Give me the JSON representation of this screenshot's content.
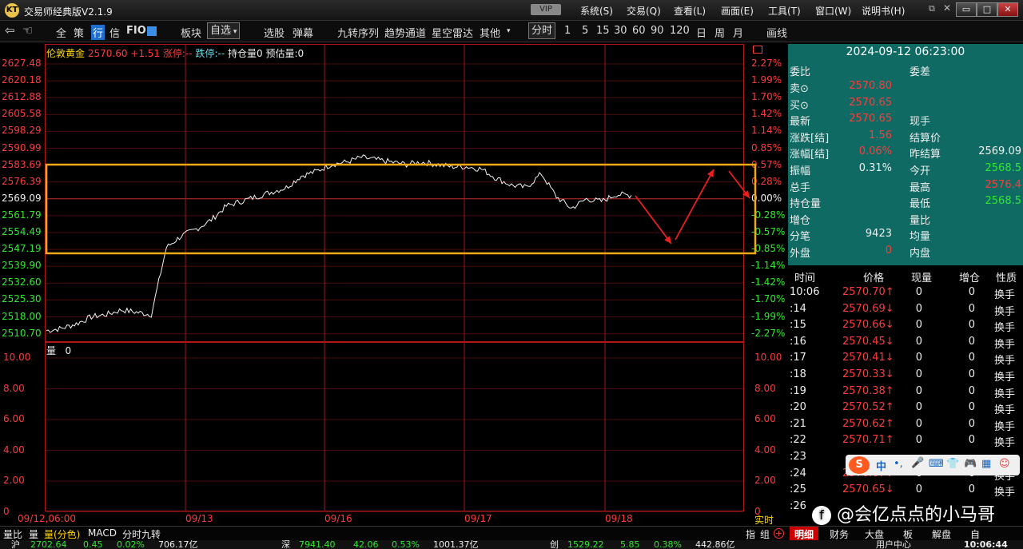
{
  "app": {
    "logo": "KT",
    "title": "交易师经典版V2.1.9",
    "vip": "VIP"
  },
  "menu": [
    "系统(S)",
    "交易(Q)",
    "查看(L)",
    "画面(E)",
    "工具(T)",
    "窗口(W)",
    "说明书(H)"
  ],
  "window_buttons": [
    "□",
    "▭",
    "✕"
  ],
  "toolbar": {
    "items": [
      "全",
      "策",
      "行",
      "信",
      "FIO"
    ],
    "block": "板块",
    "selfselect": "自选",
    "group2": [
      "选股",
      "弹幕"
    ],
    "group3": [
      "九转序列",
      "趋势通道",
      "星空雷达",
      "其他"
    ],
    "periods": [
      "分时",
      "1",
      "5",
      "15",
      "30",
      "60",
      "90",
      "120",
      "日",
      "周",
      "月"
    ],
    "draw": "画线"
  },
  "header": {
    "name": "伦敦黄金",
    "price": "2570.60",
    "change": "+1.51",
    "limit_up": "涨停:--",
    "limit_down": "跌停:--",
    "open_interest": "持仓量0",
    "est_volume": "预估量:0"
  },
  "price_axis_left": [
    "2627.48",
    "2620.18",
    "2612.88",
    "2605.58",
    "2598.29",
    "2590.99",
    "2583.69",
    "2576.39",
    "2569.09",
    "2561.79",
    "2554.49",
    "2547.19",
    "2539.90",
    "2532.60",
    "2525.30",
    "2518.00",
    "2510.70"
  ],
  "pct_axis_right": [
    "2.27%",
    "1.99%",
    "1.70%",
    "1.42%",
    "1.14%",
    "0.85%",
    "0.57%",
    "0.28%",
    "0.00%",
    "-0.28%",
    "-0.57%",
    "-0.85%",
    "-1.14%",
    "-1.42%",
    "-1.70%",
    "-1.99%",
    "-2.27%"
  ],
  "volume": {
    "label": "量",
    "value": "0",
    "axis": [
      "10.00",
      "8.00",
      "6.00",
      "4.00",
      "2.00",
      "0"
    ],
    "realtime": "实时"
  },
  "dates": [
    "09/12,06:00",
    "09/13",
    "09/16",
    "09/17",
    "09/18"
  ],
  "chart_data": {
    "type": "line",
    "title": "伦敦黄金",
    "xlabel": "",
    "ylabel": "",
    "ylim": [
      2510.7,
      2627.48
    ],
    "prev_settle": 2569.09,
    "x": [
      "09/12,06:00",
      "09/12",
      "09/12",
      "09/12",
      "09/12",
      "09/12",
      "09/12",
      "09/12",
      "09/13",
      "09/13",
      "09/13",
      "09/13",
      "09/13",
      "09/13",
      "09/13",
      "09/13",
      "09/13",
      "09/13",
      "09/16",
      "09/16",
      "09/16",
      "09/16",
      "09/16",
      "09/16",
      "09/16",
      "09/16",
      "09/16",
      "09/16",
      "09/17",
      "09/17",
      "09/17",
      "09/17",
      "09/17",
      "09/17",
      "09/17",
      "09/17",
      "09/18",
      "09/18",
      "09/18",
      "09/18"
    ],
    "series": [
      {
        "values": [
          2512,
          2513,
          2515,
          2518,
          2519,
          2521,
          2520,
          2519,
          2548,
          2553,
          2556,
          2560,
          2566,
          2568,
          2570,
          2572,
          2574,
          2579,
          2581,
          2584,
          2585,
          2587,
          2586,
          2585,
          2584,
          2585,
          2584,
          2583,
          2583,
          2582,
          2578,
          2575,
          2574,
          2580,
          2570,
          2565,
          2569,
          2568,
          2571,
          2570.6
        ]
      }
    ],
    "grid": true
  },
  "quote": {
    "datetime": "2024-09-12 06:23:00",
    "wb_label": "委比",
    "wc_label": "委差",
    "rows": [
      {
        "k": "卖⊙",
        "v": "2570.80",
        "vc": "red",
        "k2": "",
        "v2": "",
        "v2c": "white"
      },
      {
        "k": "买⊙",
        "v": "2570.65",
        "vc": "red",
        "k2": "",
        "v2": "",
        "v2c": "white"
      },
      {
        "k": "最新",
        "v": "2570.65",
        "vc": "red",
        "k2": "现手",
        "v2": "",
        "v2c": "white"
      },
      {
        "k": "涨跌[结]",
        "v": "1.56",
        "vc": "red",
        "k2": "结算价",
        "v2": "",
        "v2c": "white"
      },
      {
        "k": "涨幅[结]",
        "v": "0.06%",
        "vc": "red",
        "k2": "昨结算",
        "v2": "2569.09",
        "v2c": "white"
      },
      {
        "k": "振幅",
        "v": "0.31%",
        "vc": "white",
        "k2": "今开",
        "v2": "2568.5",
        "v2c": "green"
      },
      {
        "k": "总手",
        "v": "",
        "vc": "white",
        "k2": "最高",
        "v2": "2576.4",
        "v2c": "red"
      },
      {
        "k": "持仓量",
        "v": "",
        "vc": "white",
        "k2": "最低",
        "v2": "2568.5",
        "v2c": "green"
      },
      {
        "k": "增仓",
        "v": "",
        "vc": "white",
        "k2": "量比",
        "v2": "",
        "v2c": "white"
      },
      {
        "k": "分笔",
        "v": "9423",
        "vc": "white",
        "k2": "均量",
        "v2": "",
        "v2c": "white"
      },
      {
        "k": "外盘",
        "v": "0",
        "vc": "red",
        "k2": "内盘",
        "v2": "",
        "v2c": "white"
      }
    ]
  },
  "trades": {
    "headers": [
      "时间",
      "价格",
      "现量",
      "增仓",
      "性质"
    ],
    "rows": [
      {
        "t": "10:06",
        "p": "2570.70↑",
        "q": "0",
        "z": "0",
        "x": "换手",
        "pc": "red"
      },
      {
        "t": ":14",
        "p": "2570.69↓",
        "q": "0",
        "z": "0",
        "x": "换手",
        "pc": "red"
      },
      {
        "t": ":15",
        "p": "2570.66↓",
        "q": "0",
        "z": "0",
        "x": "换手",
        "pc": "red"
      },
      {
        "t": ":16",
        "p": "2570.45↓",
        "q": "0",
        "z": "0",
        "x": "换手",
        "pc": "red"
      },
      {
        "t": ":17",
        "p": "2570.41↓",
        "q": "0",
        "z": "0",
        "x": "换手",
        "pc": "red"
      },
      {
        "t": ":18",
        "p": "2570.33↓",
        "q": "0",
        "z": "0",
        "x": "换手",
        "pc": "red"
      },
      {
        "t": ":19",
        "p": "2570.38↑",
        "q": "0",
        "z": "0",
        "x": "换手",
        "pc": "red"
      },
      {
        "t": ":20",
        "p": "2570.52↑",
        "q": "0",
        "z": "0",
        "x": "换手",
        "pc": "red"
      },
      {
        "t": ":21",
        "p": "2570.62↑",
        "q": "0",
        "z": "0",
        "x": "换手",
        "pc": "red"
      },
      {
        "t": ":22",
        "p": "2570.71↑",
        "q": "0",
        "z": "0",
        "x": "换手",
        "pc": "red"
      },
      {
        "t": ":23",
        "p": "",
        "q": "",
        "z": "",
        "x": "",
        "pc": "red"
      },
      {
        "t": ":24",
        "p": "2570.67↓",
        "q": "0",
        "z": "0",
        "x": "换手",
        "pc": "red"
      },
      {
        "t": ":25",
        "p": "2570.65↓",
        "q": "0",
        "z": "0",
        "x": "换手",
        "pc": "red"
      },
      {
        "t": ":26",
        "p": "",
        "q": "",
        "z": "",
        "x": "",
        "pc": "red"
      }
    ]
  },
  "bottom_left_tabs": [
    "量比",
    "量",
    "量(分色)",
    "MACD",
    "分时九转"
  ],
  "bottom_right": {
    "indicator": "指",
    "group": "组",
    "tabs": [
      "明细",
      "财务",
      "大盘",
      "板",
      "解盘",
      "自"
    ]
  },
  "status": {
    "items": [
      {
        "name": "沪",
        "value": "2702.64",
        "chg": "0.45",
        "pct": "0.02%",
        "amt": "706.17亿"
      },
      {
        "name": "深",
        "value": "7941.40",
        "chg": "42.06",
        "pct": "0.53%",
        "amt": "1001.37亿"
      },
      {
        "name": "创",
        "value": "1529.22",
        "chg": "5.85",
        "pct": "0.38%",
        "amt": "442.86亿"
      }
    ],
    "service": "用户中心",
    "clock": "10:06:44"
  },
  "watermark": "@会亿点点的小马哥",
  "ime": "中"
}
